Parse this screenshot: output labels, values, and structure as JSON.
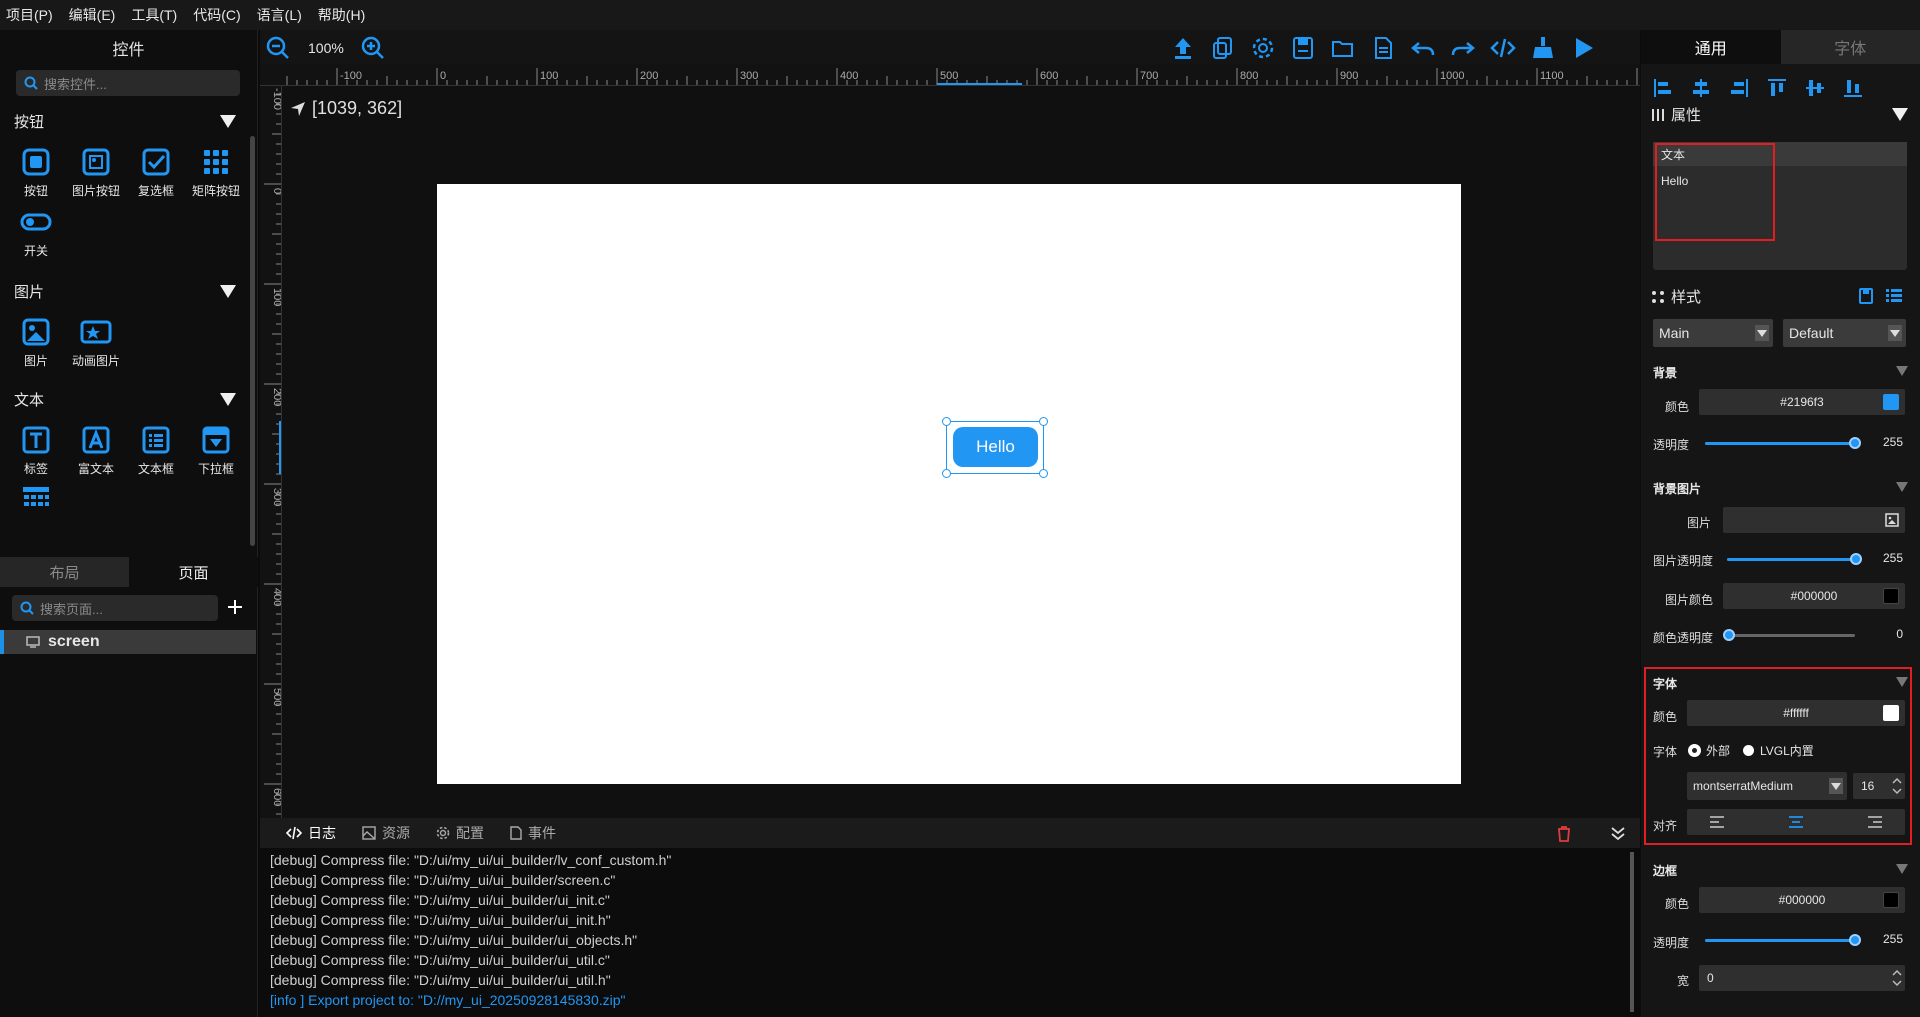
{
  "menu": [
    "项目(P)",
    "编辑(E)",
    "工具(T)",
    "代码(C)",
    "语言(L)",
    "帮助(H)"
  ],
  "left": {
    "title": "控件",
    "search_placeholder": "搜索控件...",
    "sections": [
      {
        "name": "按钮",
        "items": [
          "按钮",
          "图片按钮",
          "复选框",
          "矩阵按钮",
          "开关"
        ]
      },
      {
        "name": "图片",
        "items": [
          "图片",
          "动画图片"
        ]
      },
      {
        "name": "文本",
        "items": [
          "标签",
          "富文本",
          "文本框",
          "下拉框"
        ]
      }
    ],
    "tabs": [
      "布局",
      "页面"
    ],
    "page_search_placeholder": "搜索页面...",
    "pages": [
      "screen"
    ]
  },
  "toolbar": {
    "zoom": "100%"
  },
  "ruler": {
    "h_labels": [
      "-100",
      "0",
      "100",
      "200",
      "300",
      "400",
      "500",
      "600",
      "700",
      "800",
      "900",
      "1000",
      "1100"
    ],
    "v_labels": [
      "-100",
      "0",
      "100",
      "200",
      "300",
      "400",
      "500",
      "600"
    ]
  },
  "canvas": {
    "coord": "[1039, 362]",
    "button_text": "Hello"
  },
  "log": {
    "tabs": [
      "日志",
      "资源",
      "配置",
      "事件"
    ],
    "lines": [
      "[debug] Compress file: \"D:/ui/my_ui/ui_builder/lv_conf_custom.h\"",
      "[debug] Compress file: \"D:/ui/my_ui/ui_builder/screen.c\"",
      "[debug] Compress file: \"D:/ui/my_ui/ui_builder/ui_init.c\"",
      "[debug] Compress file: \"D:/ui/my_ui/ui_builder/ui_init.h\"",
      "[debug] Compress file: \"D:/ui/my_ui/ui_builder/ui_objects.h\"",
      "[debug] Compress file: \"D:/ui/my_ui/ui_builder/ui_util.c\"",
      "[debug] Compress file: \"D:/ui/my_ui/ui_builder/ui_util.h\"",
      "[info ] Export project to: \"D://my_ui_20250928145830.zip\""
    ]
  },
  "right": {
    "tabs": [
      "通用",
      "字体"
    ],
    "props_title": "属性",
    "text_label": "文本",
    "text_value": "Hello",
    "style_title": "样式",
    "part": "Main",
    "state": "Default",
    "bg": {
      "title": "背景",
      "color_label": "颜色",
      "color": "#2196f3",
      "opa_label": "透明度",
      "opa": "255"
    },
    "bgimg": {
      "title": "背景图片",
      "img_label": "图片",
      "img_opa_label": "图片透明度",
      "img_opa": "255",
      "img_color_label": "图片颜色",
      "img_color": "#000000",
      "color_opa_label": "颜色透明度",
      "color_opa": "0"
    },
    "font": {
      "title": "字体",
      "color_label": "颜色",
      "color": "#ffffff",
      "font_label": "字体",
      "radio_ext": "外部",
      "radio_lvgl": "LVGL内置",
      "font_name": "montserratMedium",
      "size": "16",
      "align_label": "对齐"
    },
    "border": {
      "title": "边框",
      "color_label": "颜色",
      "color": "#000000",
      "opa_label": "透明度",
      "opa": "255",
      "width_label": "宽",
      "width": "0"
    }
  }
}
